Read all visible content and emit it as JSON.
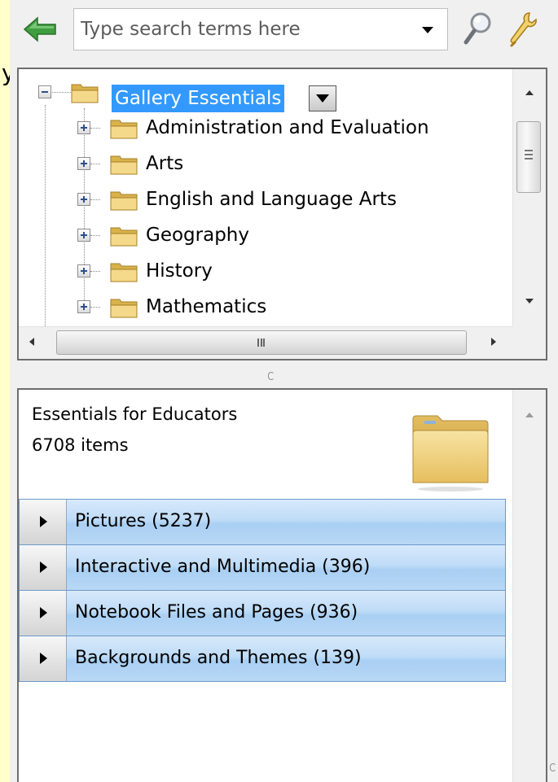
{
  "toolbar": {
    "search": {
      "placeholder": "Type search terms here",
      "value": ""
    },
    "icons": {
      "back": "back-arrow-icon",
      "dropdown": "chevron-down-icon",
      "search": "magnifier-icon",
      "tools": "wrench-icon"
    }
  },
  "tree": {
    "root": {
      "label": "Gallery Essentials",
      "selected": true,
      "expanded": true
    },
    "items": [
      {
        "label": "Administration and Evaluation"
      },
      {
        "label": "Arts"
      },
      {
        "label": "English and Language Arts"
      },
      {
        "label": "Geography"
      },
      {
        "label": "History"
      },
      {
        "label": "Mathematics"
      }
    ]
  },
  "content": {
    "collection_name": "Essentials for Educators",
    "item_count": "6708 items",
    "categories": [
      {
        "label": "Pictures (5237)"
      },
      {
        "label": "Interactive and Multimedia (396)"
      },
      {
        "label": "Notebook Files and Pages (936)"
      },
      {
        "label": "Backgrounds and Themes (139)"
      }
    ]
  },
  "colors": {
    "page_background": "#ffffcc",
    "selection": "#3399ff",
    "category_bar": "#bfdcf7",
    "back_arrow": "#3a9a3a",
    "folder": "#f3d488"
  }
}
